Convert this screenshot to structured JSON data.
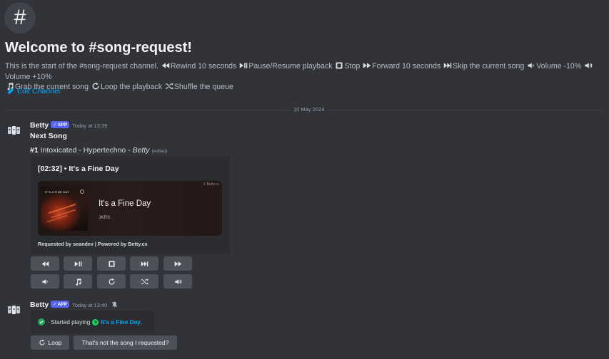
{
  "channel": {
    "hash_symbol": "#",
    "welcome_title": "Welcome to #song-request!",
    "desc_intro": "This is the start of the #song-request channel.",
    "commands": [
      {
        "icon": "rewind-icon",
        "label": "Rewind 10 seconds"
      },
      {
        "icon": "play-pause-icon",
        "label": "Pause/Resume playback"
      },
      {
        "icon": "stop-icon",
        "label": "Stop"
      },
      {
        "icon": "forward-icon",
        "label": "Forward 10 seconds"
      },
      {
        "icon": "skip-icon",
        "label": "Skip the current song"
      },
      {
        "icon": "volume-down-icon",
        "label": "Volume -10%"
      },
      {
        "icon": "volume-up-icon",
        "label": "Volume +10%"
      },
      {
        "icon": "music-note-icon",
        "label": "Grab the current song"
      },
      {
        "icon": "loop-icon",
        "label": "Loop the playback"
      },
      {
        "icon": "shuffle-icon",
        "label": "Shuffle the queue"
      }
    ],
    "edit_label": "Edit Channel"
  },
  "divider_date": "10 May 2024",
  "message1": {
    "author": "Betty",
    "badge": "APP",
    "time": "Today at 13:39",
    "heading": "Next Song",
    "track_number": "#1",
    "track_text": "Intoxicated - Hypertechno - ",
    "track_artist": "Betty",
    "edited": "(edited)",
    "embed": {
      "title": "[02:32] • It's a Fine Day",
      "card_song": "It's a Fine Day",
      "card_artist": "JKRS",
      "card_copyright": "© Betty.cx",
      "album_text": "IT'S A FINE DAY",
      "footer": "Requested by seandev | Powered by Betty.cx"
    }
  },
  "controls_row1": [
    "rewind-icon",
    "play-pause-icon",
    "stop-icon",
    "skip-icon",
    "forward-icon"
  ],
  "controls_row2": [
    "volume-down-icon",
    "music-note-icon",
    "loop-icon",
    "shuffle-icon",
    "volume-up-icon"
  ],
  "message2": {
    "author": "Betty",
    "badge": "APP",
    "time": "Today at 13:40",
    "prefix": "· Started playing",
    "song_link": "It's a Fine Day",
    "suffix": "."
  },
  "buttons": {
    "loop_label": "Loop",
    "wrong_song_label": "That's not the song I requested?"
  },
  "colors": {
    "background": "#313338",
    "embed": "#2b2d31",
    "button": "#4e5058",
    "link": "#00a8fc",
    "app_badge": "#5865f2",
    "success": "#23a55a",
    "spotify": "#1ed760"
  }
}
